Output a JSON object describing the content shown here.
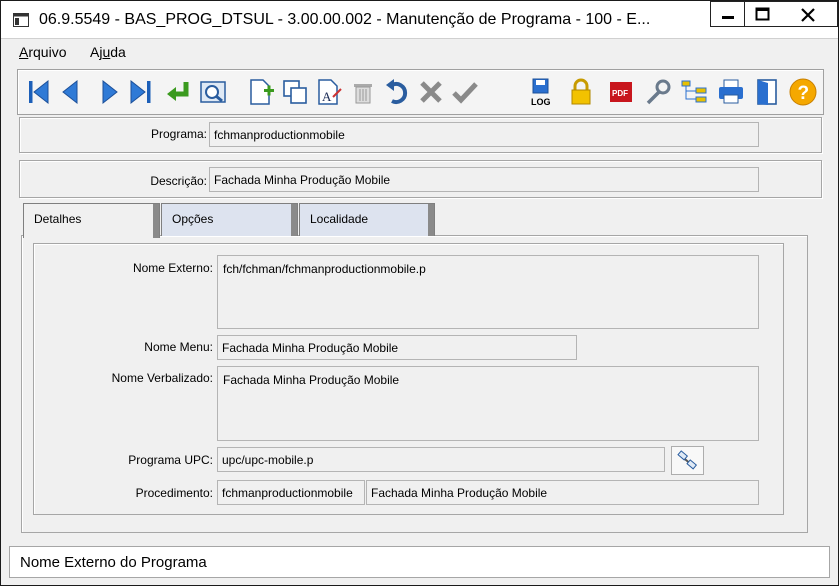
{
  "window": {
    "title": "06.9.5549 - BAS_PROG_DTSUL - 3.00.00.002 - Manutenção de Programa - 100 - E...",
    "minimize": "minimize",
    "maximize": "maximize",
    "close": "close"
  },
  "menu": {
    "items": [
      {
        "accel": "A",
        "rest": "rquivo"
      },
      {
        "prefix": "Aj",
        "accel": "u",
        "rest": "da"
      }
    ]
  },
  "toolbar": {
    "icons": [
      "first-record-icon",
      "previous-record-icon",
      "next-record-icon",
      "last-record-icon",
      "go-to-icon",
      "search-icon",
      "add-icon",
      "copy-icon",
      "edit-icon",
      "delete-icon",
      "undo-icon",
      "cancel-icon",
      "confirm-icon",
      "log-icon",
      "lock-icon",
      "pdf-icon",
      "settings-icon",
      "tree-icon",
      "print-icon",
      "exit-icon",
      "help-icon"
    ],
    "log_label": "LOG",
    "pdf_label": "PDF"
  },
  "header": {
    "programa_label": "Programa:",
    "programa_value": "fchmanproductionmobile",
    "descricao_label": "Descrição:",
    "descricao_value": "Fachada Minha Produção Mobile"
  },
  "tabs": [
    {
      "label": "Detalhes",
      "active": true
    },
    {
      "label": "Opções",
      "active": false
    },
    {
      "label": "Localidade",
      "active": false
    }
  ],
  "details": {
    "nome_externo_label": "Nome Externo:",
    "nome_externo_value": "fch/fchman/fchmanproductionmobile.p",
    "nome_menu_label": "Nome Menu:",
    "nome_menu_value": "Fachada Minha Produção Mobile",
    "nome_verbalizado_label": "Nome Verbalizado:",
    "nome_verbalizado_value": "Fachada Minha Produção Mobile",
    "programa_upc_label": "Programa UPC:",
    "programa_upc_value": "upc/upc-mobile.p",
    "procedimento_label": "Procedimento:",
    "procedimento_code": "fchmanproductionmobile",
    "procedimento_desc": "Fachada Minha Produção Mobile"
  },
  "status": {
    "text": "Nome Externo do Programa"
  }
}
